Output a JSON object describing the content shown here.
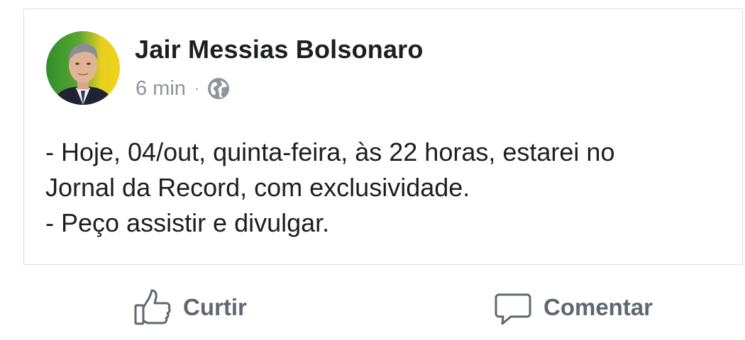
{
  "post": {
    "author": "Jair Messias Bolsonaro",
    "timestamp": "6 min",
    "separator": "·",
    "privacy_icon": "globe-icon",
    "avatar_icon": "profile-photo",
    "body_lines": [
      "- Hoje, 04/out, quinta-feira, às 22 horas, estarei no",
      "Jornal da Record, com exclusividade.",
      "- Peço assistir e divulgar."
    ]
  },
  "actions": {
    "like_label": "Curtir",
    "like_icon": "thumbs-up-icon",
    "comment_label": "Comentar",
    "comment_icon": "comment-icon"
  },
  "colors": {
    "text_primary": "#1c1e21",
    "text_secondary": "#90949c",
    "action_text": "#606770",
    "border": "#dddfe2",
    "avatar_bg_green": "#2f8f2c",
    "avatar_bg_yellow": "#f4d21c"
  }
}
